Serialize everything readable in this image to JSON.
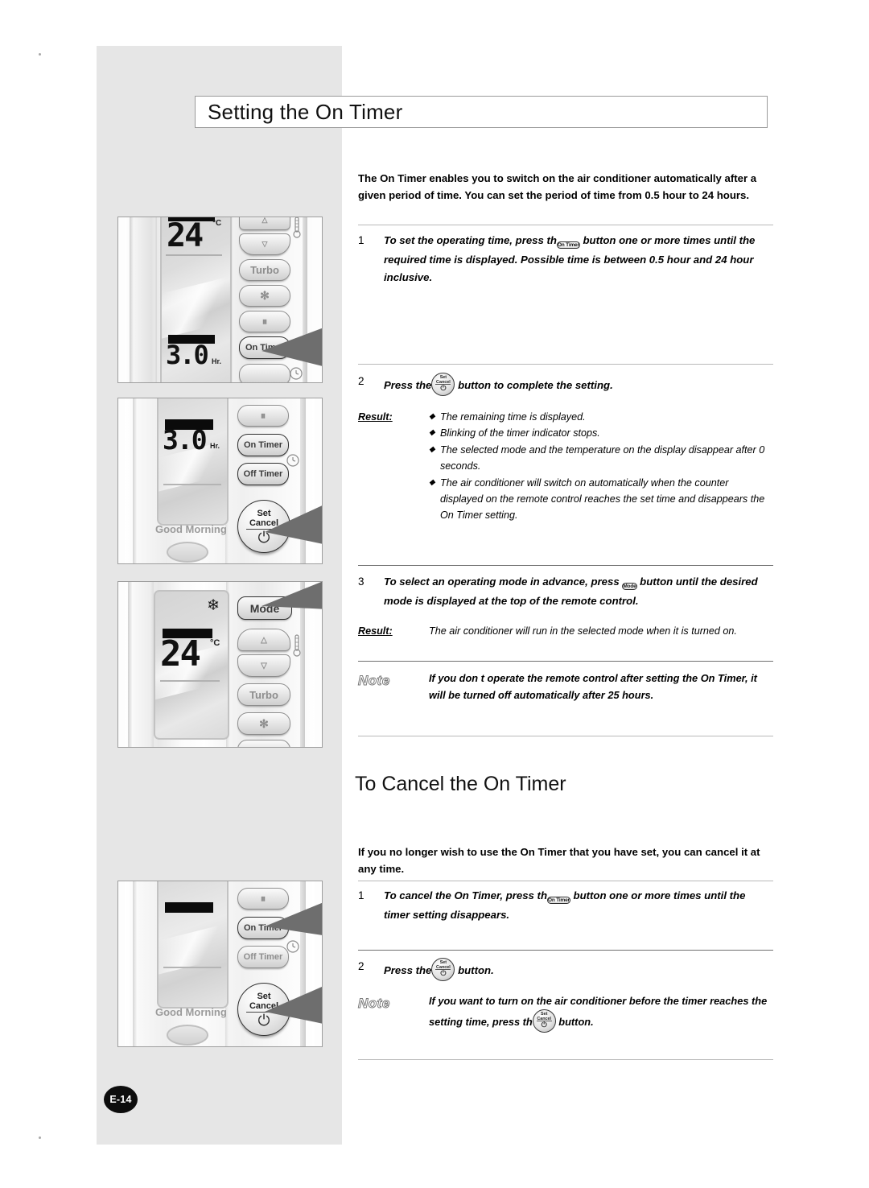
{
  "page": {
    "number_label": "E-14",
    "title": "Setting the On Timer"
  },
  "intro": {
    "text": "The On Timer enables you to switch on the air conditioner automatically after a given period of time. You can set the period of time from 0.5 hour to 24 hours."
  },
  "steps": [
    {
      "num": "1",
      "text_before": "To set the operating time, press th",
      "button": "On Timer",
      "text_after": "button one or more times until the required time is displayed. Possible time is between 0.5 hour and 24 hour inclusive."
    },
    {
      "num": "2",
      "text_before": "Press the",
      "button": "Set Cancel",
      "text_after": "button to complete the setting.",
      "result_label": "Result:",
      "result_bullets": [
        "The remaining time is displayed.",
        "Blinking of the timer indicator stops.",
        "The selected mode and the temperature on the display disappear after    0 seconds.",
        "The air conditioner will switch on automatically when the counter displayed on the remote control reaches the set time and disappears the On Timer setting."
      ]
    },
    {
      "num": "3",
      "text_before": "To select an operating mode in advance, press",
      "button": "Mode",
      "text_after": "button until the desired mode is displayed at the top of the remote control.",
      "result_label": "Result:",
      "result_text": "The air conditioner will run in the selected mode when it is turned on."
    }
  ],
  "note_top": {
    "label": "Note",
    "text": "If you don    t operate the remote control after setting the On Timer, it will be turned off automatically after 25 hours."
  },
  "section2": {
    "heading_cap": "To",
    "heading_rest": " Cancel the On Timer",
    "intro": "If you no longer wish to use the On Timer that you have set, you can cancel it at any time.",
    "steps": [
      {
        "num": "1",
        "text_before": "To cancel the On Timer, press th",
        "button": "On Timer",
        "text_after": "button one or more times until the timer setting disappears."
      },
      {
        "num": "2",
        "text_before": "Press the",
        "button": "Set Cancel",
        "text_after": "button."
      }
    ],
    "note": {
      "label": "Note",
      "text_before": "If you want to turn on the air conditioner before the timer reaches the setting time, press th",
      "button": "Set Cancel",
      "text_after": "button."
    }
  },
  "inline_buttons": {
    "on_timer": "On Timer",
    "mode": "Mode",
    "set": "Set",
    "cancel": "Cancel"
  },
  "remotes": [
    {
      "name": "remote-set-on-timer",
      "lcd_temp": "24",
      "lcd_unit": "°C",
      "lcd_hours": "3.0",
      "lcd_hours_unit": "Hr.",
      "buttons": [
        "Turbo",
        "On Timer"
      ],
      "icons": [
        "up-arrow-icon",
        "down-arrow-icon",
        "fan-icon",
        "swing-icon",
        "thermometer-icon",
        "clock-icon"
      ],
      "pointer_target": "On Timer"
    },
    {
      "name": "remote-set-cancel",
      "lcd_hours": "3.0",
      "lcd_hours_unit": "Hr.",
      "buttons": [
        "On Timer",
        "Off Timer",
        "Set",
        "Cancel"
      ],
      "label_good_morning": "Good Morning",
      "icons": [
        "swing-icon",
        "clock-icon",
        "power-icon"
      ],
      "pointer_target": "Set Cancel"
    },
    {
      "name": "remote-mode",
      "lcd_temp": "24",
      "lcd_unit": "°C",
      "buttons": [
        "Mode",
        "Turbo"
      ],
      "icons": [
        "snowflake-icon",
        "up-arrow-icon",
        "down-arrow-icon",
        "fan-icon",
        "thermometer-icon"
      ],
      "pointer_target": "Mode"
    },
    {
      "name": "remote-cancel-on-timer",
      "buttons": [
        "On Timer",
        "Off Timer",
        "Set",
        "Cancel"
      ],
      "label_good_morning": "Good Morning",
      "icons": [
        "swing-icon",
        "clock-icon",
        "power-icon"
      ],
      "pointer_target": "On Timer, Set Cancel"
    }
  ],
  "colors": {
    "sidebar_gray": "#e6e6e6",
    "rule": "#b9b9b9",
    "page_badge": "#0d0d0d"
  }
}
